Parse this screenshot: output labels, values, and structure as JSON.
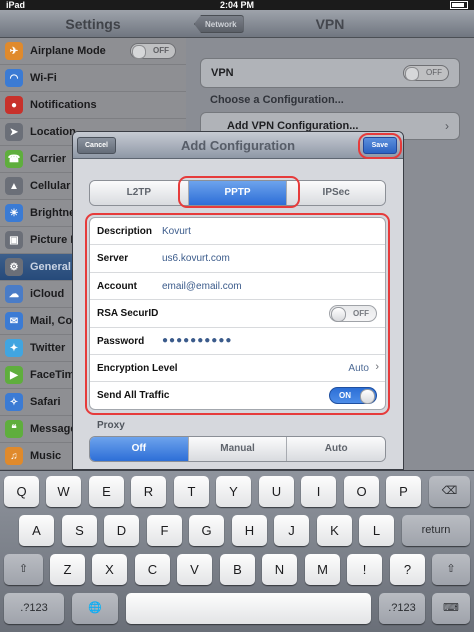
{
  "status_bar": {
    "carrier": "iPad",
    "time": "2:04 PM"
  },
  "settings": {
    "title": "Settings",
    "items": [
      {
        "label": "Airplane Mode",
        "icon": "airplane-icon",
        "color": "#e08a2c",
        "toggle": "OFF"
      },
      {
        "label": "Wi-Fi",
        "icon": "wifi-icon",
        "color": "#3b7bd4"
      },
      {
        "label": "Notifications",
        "icon": "notifications-icon",
        "color": "#c8312b"
      },
      {
        "label": "Location",
        "icon": "location-icon",
        "color": "#6b6f78"
      },
      {
        "label": "Carrier",
        "icon": "phone-icon",
        "color": "#5fae3d"
      },
      {
        "label": "Cellular",
        "icon": "cellular-icon",
        "color": "#6b6f78"
      },
      {
        "label": "Brightne",
        "icon": "brightness-icon",
        "color": "#3b7bd4"
      },
      {
        "label": "Picture F",
        "icon": "picture-frame-icon",
        "color": "#6b6f78"
      },
      {
        "label": "General",
        "icon": "gear-icon",
        "color": "#6b6f78",
        "selected": true
      },
      {
        "label": "iCloud",
        "icon": "cloud-icon",
        "color": "#4a7cc7"
      },
      {
        "label": "Mail, Co",
        "icon": "mail-icon",
        "color": "#3b7bd4"
      },
      {
        "label": "Twitter",
        "icon": "twitter-icon",
        "color": "#41a5e0"
      },
      {
        "label": "FaceTim",
        "icon": "facetime-icon",
        "color": "#5fae3d"
      },
      {
        "label": "Safari",
        "icon": "compass-icon",
        "color": "#3b7bd4"
      },
      {
        "label": "Message",
        "icon": "message-icon",
        "color": "#5fae3d"
      },
      {
        "label": "Music",
        "icon": "music-icon",
        "color": "#e08a2c"
      }
    ]
  },
  "vpn": {
    "back_label": "Network",
    "title": "VPN",
    "vpn_label": "VPN",
    "vpn_toggle": "OFF",
    "choose_label": "Choose a Configuration...",
    "add_label": "Add VPN Configuration..."
  },
  "modal": {
    "title": "Add Configuration",
    "cancel_label": "Cancel",
    "save_label": "Save",
    "tabs": [
      "L2TP",
      "PPTP",
      "IPSec"
    ],
    "fields": {
      "description_label": "Description",
      "description_value": "Kovurt",
      "server_label": "Server",
      "server_value": "us6.kovurt.com",
      "account_label": "Account",
      "account_value": "email@email.com",
      "rsa_label": "RSA SecurID",
      "rsa_toggle": "OFF",
      "password_label": "Password",
      "password_value": "●●●●●●●●●●",
      "encryption_label": "Encryption Level",
      "encryption_value": "Auto",
      "send_all_label": "Send All Traffic",
      "send_all_toggle": "ON"
    },
    "proxy_label": "Proxy",
    "proxy_options": [
      "Off",
      "Manual",
      "Auto"
    ]
  },
  "keyboard": {
    "row1": [
      "Q",
      "W",
      "E",
      "R",
      "T",
      "Y",
      "U",
      "I",
      "O",
      "P"
    ],
    "row2": [
      "A",
      "S",
      "D",
      "F",
      "G",
      "H",
      "J",
      "K",
      "L"
    ],
    "row3": [
      "Z",
      "X",
      "C",
      "V",
      "B",
      "N",
      "M",
      "!",
      "?"
    ],
    "return_label": "return",
    "numbers_label": ".?123",
    "backspace_glyph": "⌫",
    "shift_glyph": "⇧",
    "globe_glyph": "🌐",
    "hide_glyph": "⌨"
  },
  "colors": {
    "accent": "#2d6ed7",
    "highlight": "#e63b3b"
  }
}
